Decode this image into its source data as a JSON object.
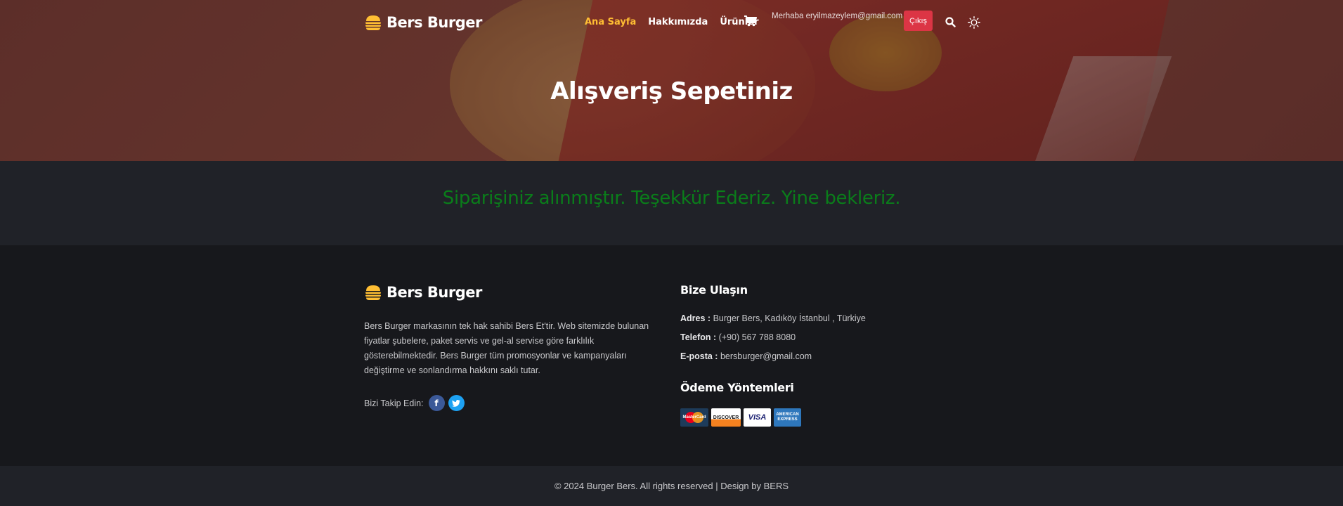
{
  "brand": {
    "name": "Bers Burger",
    "accent": "#ffbe33"
  },
  "nav": {
    "links": [
      {
        "label": "Ana Sayfa",
        "active": true
      },
      {
        "label": "Hakkımızda",
        "active": false
      },
      {
        "label": "Ürünler",
        "active": false
      }
    ],
    "cart_icon": "cart-icon",
    "greeting": "Merhaba eryilmazeylem@gmail.com",
    "logout_label": "Çıkış",
    "logout_color": "#dc3545",
    "search_icon": "search-icon",
    "theme_icon": "sun-icon"
  },
  "hero": {
    "title": "Alışveriş Sepetiniz"
  },
  "message": {
    "text": "Siparişiniz alınmıştır. Teşekkür Ederiz. Yine bekleriz.",
    "color": "#0a7d1a"
  },
  "footer": {
    "about": "Bers Burger markasının tek hak sahibi Bers Et'tir. Web sitemizde bulunan fiyatlar şubelere, paket servis ve gel-al servise göre farklılık gösterebilmektedir. Bers Burger tüm promosyonlar ve kampanyaları değiştirme ve sonlandırma hakkını saklı tutar.",
    "follow_label": "Bizi Takip Edin:",
    "social": [
      "facebook-icon",
      "twitter-icon"
    ],
    "contact": {
      "heading": "Bize Ulaşın",
      "address_label": "Adres :",
      "address": "Burger Bers, Kadıköy İstanbul , Türkiye",
      "phone_label": "Telefon :",
      "phone": "(+90) 567 788 8080",
      "email_label": "E-posta :",
      "email": "bersburger@gmail.com"
    },
    "payment": {
      "heading": "Ödeme Yöntemleri",
      "cards": [
        "MasterCard",
        "DISCOVER",
        "VISA",
        "AMERICAN EXPRESS"
      ]
    }
  },
  "copyright": "© 2024 Burger Bers. All rights reserved | Design by BERS"
}
